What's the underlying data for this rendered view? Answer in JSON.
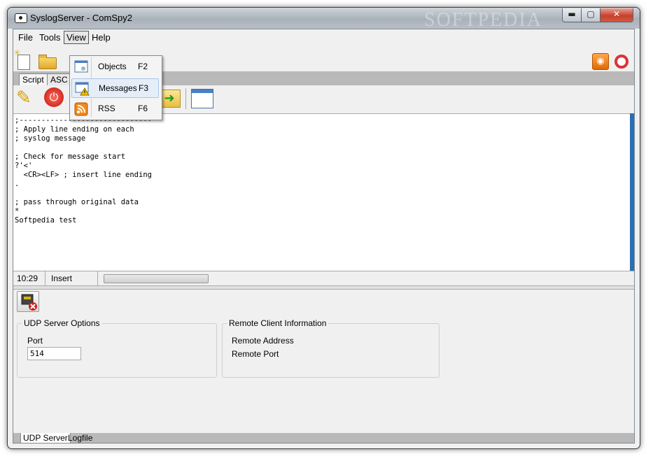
{
  "window": {
    "title": "SyslogServer - ComSpy2",
    "watermark": "SOFTPEDIA"
  },
  "menubar": {
    "file": "File",
    "tools": "Tools",
    "view": "View",
    "help": "Help"
  },
  "view_menu": {
    "items": [
      {
        "label": "Objects",
        "shortcut": "F2",
        "icon": "objects-icon"
      },
      {
        "label": "Messages",
        "shortcut": "F3",
        "icon": "messages-warning-icon"
      },
      {
        "label": "RSS",
        "shortcut": "F6",
        "icon": "rss-icon"
      }
    ],
    "highlighted": "Messages"
  },
  "tabs": {
    "script": "Script",
    "ascii": "ASC"
  },
  "editor": {
    "lines": [
      ";------------------------------",
      "; Apply line ending on each",
      "; syslog message",
      "",
      "; Check for message start",
      "?'<'",
      "  <CR><LF> ; insert line ending",
      ".",
      "",
      "; pass through original data",
      "*",
      "Softpedia test"
    ]
  },
  "status": {
    "position": "10:29",
    "mode": "Insert"
  },
  "udp_options": {
    "title": "UDP Server Options",
    "port_label": "Port",
    "port_value": "514"
  },
  "remote_info": {
    "title": "Remote Client Information",
    "address_label": "Remote Address",
    "port_label": "Remote Port"
  },
  "bottom_tabs": {
    "udp_server": "UDP Server",
    "logfile": "Logfile"
  },
  "colors": {
    "accent": "#2a6fb3",
    "close_button": "#c7402c",
    "rss": "#e06a00"
  }
}
